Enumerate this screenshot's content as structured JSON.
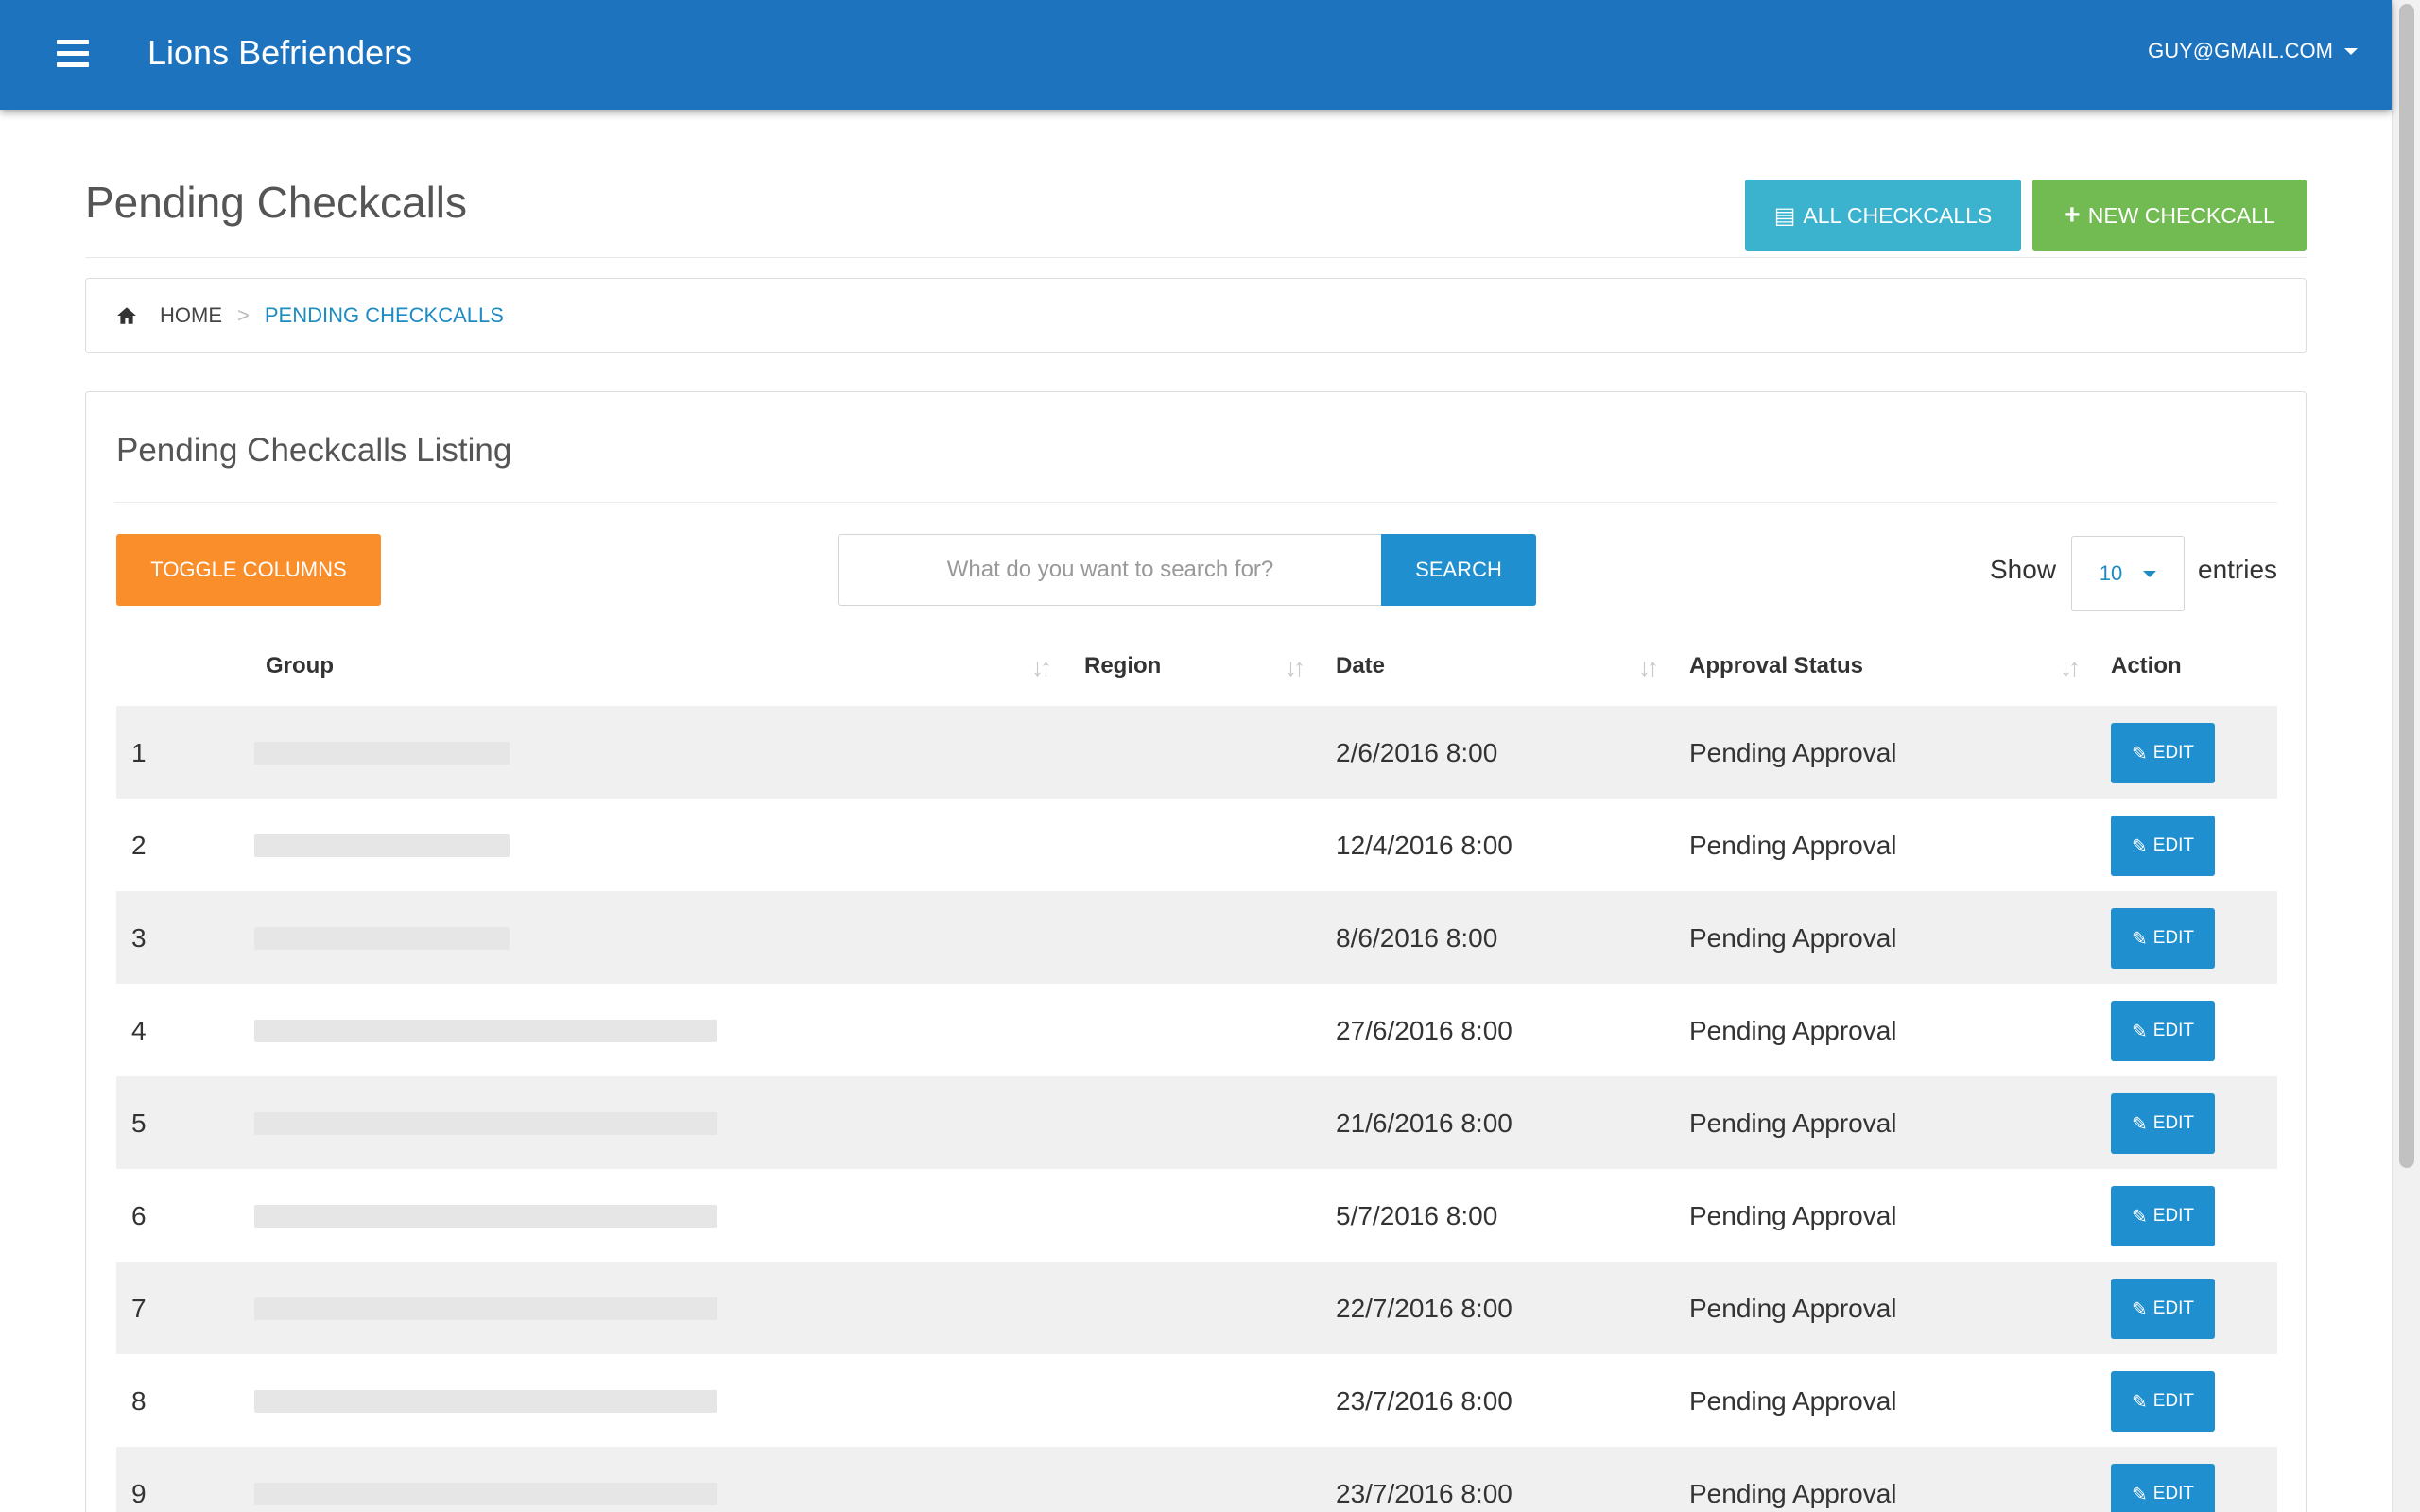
{
  "navbar": {
    "brand": "Lions Befrienders",
    "user": "GUY@GMAIL.COM"
  },
  "page": {
    "title": "Pending Checkcalls"
  },
  "header_buttons": {
    "all": "ALL CHECKCALLS",
    "new": "NEW CHECKCALL"
  },
  "breadcrumb": {
    "home": "HOME",
    "separator": ">",
    "current": "PENDING CHECKCALLS"
  },
  "panel": {
    "title": "Pending Checkcalls Listing"
  },
  "toolbar": {
    "toggle_columns": "TOGGLE COLUMNS",
    "search_placeholder": "What do you want to search for?",
    "search_button": "SEARCH",
    "show_label": "Show",
    "entries_value": "10",
    "entries_label": "entries"
  },
  "table": {
    "columns": {
      "group": "Group",
      "region": "Region",
      "date": "Date",
      "status": "Approval Status",
      "action": "Action"
    },
    "edit_label": "EDIT",
    "rows": [
      {
        "num": "1",
        "date": "2/6/2016 8:00",
        "status": "Pending Approval"
      },
      {
        "num": "2",
        "date": "12/4/2016 8:00",
        "status": "Pending Approval"
      },
      {
        "num": "3",
        "date": "8/6/2016 8:00",
        "status": "Pending Approval"
      },
      {
        "num": "4",
        "date": "27/6/2016 8:00",
        "status": "Pending Approval"
      },
      {
        "num": "5",
        "date": "21/6/2016 8:00",
        "status": "Pending Approval"
      },
      {
        "num": "6",
        "date": "5/7/2016 8:00",
        "status": "Pending Approval"
      },
      {
        "num": "7",
        "date": "22/7/2016 8:00",
        "status": "Pending Approval"
      },
      {
        "num": "8",
        "date": "23/7/2016 8:00",
        "status": "Pending Approval"
      },
      {
        "num": "9",
        "date": "23/7/2016 8:00",
        "status": "Pending Approval"
      }
    ]
  },
  "colors": {
    "navbar": "#1e73be",
    "info": "#3bb3cf",
    "success": "#72bb53",
    "warning": "#f98e2a",
    "primary": "#1f8fcf",
    "link": "#1e8bc3"
  },
  "icons": {
    "menu": "hamburger-icon",
    "home": "home-icon",
    "list": "list-icon",
    "plus": "plus-icon",
    "edit": "edit-icon",
    "sort": "sort-icon",
    "caret": "caret-down-icon"
  }
}
